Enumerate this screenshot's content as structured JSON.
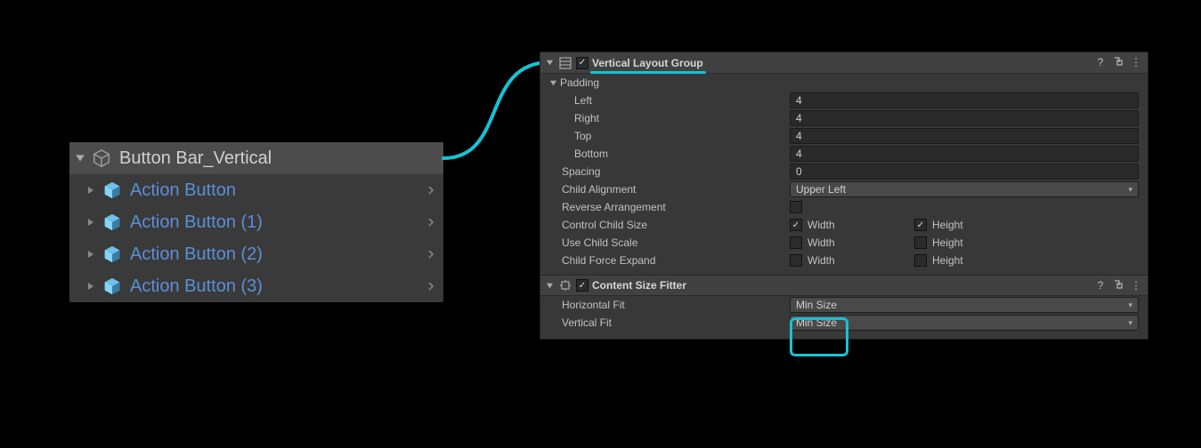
{
  "hierarchy": {
    "parent": "Button Bar_Vertical",
    "children": [
      "Action Button",
      "Action Button (1)",
      "Action Button (2)",
      "Action Button (3)"
    ]
  },
  "inspector": {
    "vlg": {
      "title": "Vertical Layout Group",
      "padding_label": "Padding",
      "left_label": "Left",
      "left": "4",
      "right_label": "Right",
      "right": "4",
      "top_label": "Top",
      "top": "4",
      "bottom_label": "Bottom",
      "bottom": "4",
      "spacing_label": "Spacing",
      "spacing": "0",
      "child_align_label": "Child Alignment",
      "child_align": "Upper Left",
      "reverse_label": "Reverse Arrangement",
      "control_label": "Control Child Size",
      "use_scale_label": "Use Child Scale",
      "force_expand_label": "Child Force Expand",
      "width_label": "Width",
      "height_label": "Height"
    },
    "csf": {
      "title": "Content Size Fitter",
      "hfit_label": "Horizontal Fit",
      "hfit": "Min Size",
      "vfit_label": "Vertical Fit",
      "vfit": "Min Size"
    }
  }
}
